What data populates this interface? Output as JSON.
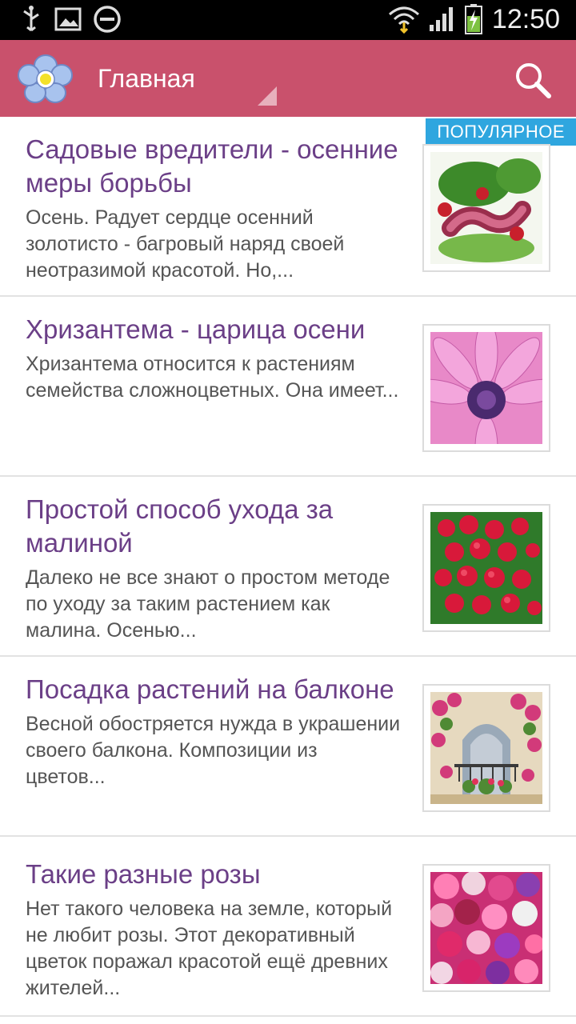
{
  "statusbar": {
    "time": "12:50"
  },
  "actionbar": {
    "title": "Главная"
  },
  "badge": "ПОПУЛЯРНОЕ",
  "articles": [
    {
      "title": "Садовые вредители - осенние меры борьбы",
      "desc": "Осень. Радует сердце осенний золотисто - багровый наряд своей неотразимой красотой. Но,..."
    },
    {
      "title": "Хризантема - царица осени",
      "desc": "Хризантема относится к растениям семейства сложноцветных. Она имеет..."
    },
    {
      "title": "Простой способ ухода за малиной",
      "desc": "Далеко не все знают о простом методе по уходу за таким растением как малина. Осенью..."
    },
    {
      "title": "Посадка растений на балконе",
      "desc": "Весной обостряется нужда в украшении своего балкона. Композиции из цветов..."
    },
    {
      "title": "Такие разные розы",
      "desc": "Нет такого человека на земле, который не любит розы. Этот декоративный цветок поражал красотой ещё древних жителей..."
    }
  ]
}
